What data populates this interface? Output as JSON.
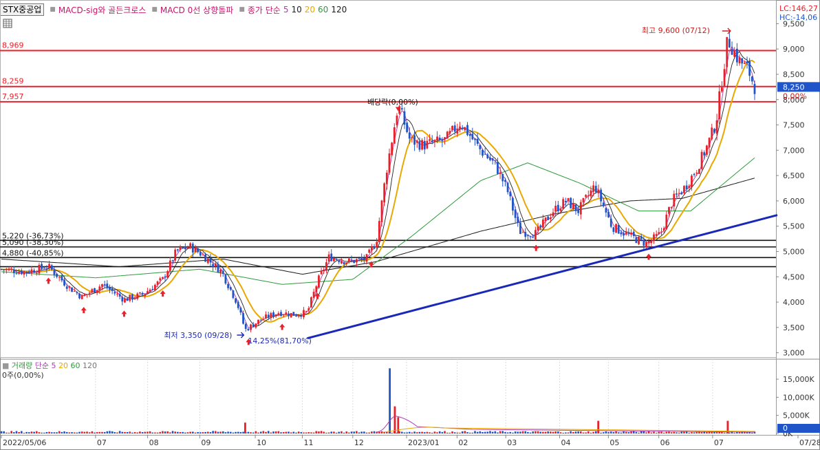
{
  "header": {
    "ticker": "STX중공업",
    "indicators": [
      "MACD-sig와 골든크로스",
      "MACD 0선 상향돌파"
    ],
    "ma_label": "종가 단순",
    "ma_periods": [
      "5",
      "10",
      "20",
      "60",
      "120"
    ],
    "lc": "LC:146,27",
    "hc": "HC:-14,06"
  },
  "volume_panel": {
    "label": "거래량",
    "ma_label": "단순",
    "ma_periods": [
      "5",
      "20",
      "60",
      "120"
    ],
    "sub_label": "0주(0,00%)"
  },
  "annotations": {
    "high": "최고 9,600 (07/12)",
    "low": "최저 3,350 (09/28)",
    "low_pct": "14,25%(81,70%)",
    "dividend": "배당락(0,00%)"
  },
  "right_tags": {
    "price": "8,250",
    "pct": "0,00%",
    "volume": "0"
  },
  "colors": {
    "up": "#e8202a",
    "down": "#1f55c8",
    "ma5": "#b03ab8",
    "ma10": "#202020",
    "ma20": "#e8a800",
    "ma60": "#2e9a3a",
    "ma120": "#1a1a1a",
    "trend": "#1a28b8",
    "level": "#e8202a"
  },
  "chart_data": [
    {
      "type": "candlestick",
      "title": "STX중공업",
      "y_range": [
        2900,
        9750
      ],
      "y_ticks": [
        "9,500",
        "9,000",
        "8,500",
        "8,000",
        "7,500",
        "7,000",
        "6,500",
        "6,000",
        "5,500",
        "5,000",
        "4,500",
        "4,000",
        "3,500",
        "3,000"
      ],
      "x_ticks": [
        "2022/05/06",
        "07",
        "08",
        "09",
        "10",
        "11",
        "12",
        "2023/01",
        "02",
        "03",
        "04",
        "05",
        "06",
        "07",
        "07/28"
      ],
      "red_levels": [
        {
          "label": "8,969",
          "value": 8969
        },
        {
          "label": "8,259",
          "value": 8259
        },
        {
          "label": "7,957",
          "value": 7957
        }
      ],
      "black_levels": [
        {
          "label": "5,220 (-36,73%)",
          "value": 5220
        },
        {
          "label": "5,090 (-38,30%)",
          "value": 5090
        },
        {
          "label": "4,880 (-40,85%)",
          "value": 4880
        },
        {
          "value": 4700
        }
      ],
      "trend_line": {
        "from": {
          "date": "2022-09-28",
          "value": 3240
        },
        "to": {
          "date": "2023-07-31",
          "value": 5720
        }
      },
      "price_anchors": [
        {
          "date": "2022-05-06",
          "close": 4650
        },
        {
          "date": "2022-05-20",
          "close": 4600
        },
        {
          "date": "2022-06-03",
          "close": 4700
        },
        {
          "date": "2022-06-15",
          "close": 4300
        },
        {
          "date": "2022-06-23",
          "close": 4100
        },
        {
          "date": "2022-07-05",
          "close": 4350
        },
        {
          "date": "2022-07-18",
          "close": 4050
        },
        {
          "date": "2022-07-29",
          "close": 4150
        },
        {
          "date": "2022-08-10",
          "close": 4450
        },
        {
          "date": "2022-08-18",
          "close": 5000
        },
        {
          "date": "2022-08-26",
          "close": 5100
        },
        {
          "date": "2022-09-02",
          "close": 4950
        },
        {
          "date": "2022-09-14",
          "close": 4600
        },
        {
          "date": "2022-09-23",
          "close": 4000
        },
        {
          "date": "2022-09-28",
          "close": 3450
        },
        {
          "date": "2022-10-07",
          "close": 3650
        },
        {
          "date": "2022-10-18",
          "close": 3800
        },
        {
          "date": "2022-10-28",
          "close": 3750
        },
        {
          "date": "2022-11-04",
          "close": 3800
        },
        {
          "date": "2022-11-10",
          "close": 4400
        },
        {
          "date": "2022-11-17",
          "close": 4900
        },
        {
          "date": "2022-11-28",
          "close": 4800
        },
        {
          "date": "2022-12-09",
          "close": 4850
        },
        {
          "date": "2022-12-15",
          "close": 5200
        },
        {
          "date": "2022-12-21",
          "close": 6600
        },
        {
          "date": "2022-12-28",
          "close": 7900
        },
        {
          "date": "2023-01-04",
          "close": 7200
        },
        {
          "date": "2023-01-12",
          "close": 7100
        },
        {
          "date": "2023-01-25",
          "close": 7200
        },
        {
          "date": "2023-02-03",
          "close": 7550
        },
        {
          "date": "2023-02-15",
          "close": 7000
        },
        {
          "date": "2023-02-24",
          "close": 6700
        },
        {
          "date": "2023-03-03",
          "close": 6200
        },
        {
          "date": "2023-03-10",
          "close": 5400
        },
        {
          "date": "2023-03-20",
          "close": 5350
        },
        {
          "date": "2023-03-30",
          "close": 5800
        },
        {
          "date": "2023-04-07",
          "close": 6000
        },
        {
          "date": "2023-04-14",
          "close": 5800
        },
        {
          "date": "2023-04-24",
          "close": 6300
        },
        {
          "date": "2023-05-04",
          "close": 5500
        },
        {
          "date": "2023-05-15",
          "close": 5300
        },
        {
          "date": "2023-05-25",
          "close": 5150
        },
        {
          "date": "2023-06-02",
          "close": 5350
        },
        {
          "date": "2023-06-09",
          "close": 6000
        },
        {
          "date": "2023-06-16",
          "close": 6250
        },
        {
          "date": "2023-06-23",
          "close": 6600
        },
        {
          "date": "2023-06-30",
          "close": 7100
        },
        {
          "date": "2023-07-05",
          "close": 7550
        },
        {
          "date": "2023-07-12",
          "close": 9200
        },
        {
          "date": "2023-07-18",
          "close": 8800
        },
        {
          "date": "2023-07-24",
          "close": 8600
        },
        {
          "date": "2023-07-28",
          "close": 8250
        }
      ],
      "ma60_points": [
        {
          "date": "2022-05-06",
          "value": 4600
        },
        {
          "date": "2022-07-01",
          "value": 4480
        },
        {
          "date": "2022-09-01",
          "value": 4650
        },
        {
          "date": "2022-10-20",
          "value": 4350
        },
        {
          "date": "2022-12-01",
          "value": 4450
        },
        {
          "date": "2023-01-05",
          "value": 5300
        },
        {
          "date": "2023-02-15",
          "value": 6400
        },
        {
          "date": "2023-03-15",
          "value": 6750
        },
        {
          "date": "2023-04-15",
          "value": 6350
        },
        {
          "date": "2023-05-20",
          "value": 5800
        },
        {
          "date": "2023-06-20",
          "value": 5800
        },
        {
          "date": "2023-07-28",
          "value": 6850
        }
      ],
      "ma120_points": [
        {
          "date": "2022-05-06",
          "value": 4850
        },
        {
          "date": "2022-07-15",
          "value": 4700
        },
        {
          "date": "2022-09-15",
          "value": 4850
        },
        {
          "date": "2022-11-01",
          "value": 4550
        },
        {
          "date": "2022-12-15",
          "value": 4800
        },
        {
          "date": "2023-02-15",
          "value": 5400
        },
        {
          "date": "2023-04-01",
          "value": 5750
        },
        {
          "date": "2023-05-15",
          "value": 6000
        },
        {
          "date": "2023-06-15",
          "value": 6050
        },
        {
          "date": "2023-07-28",
          "value": 6450
        }
      ],
      "buy_signal_dates": [
        "2022-06-03",
        "2022-06-24",
        "2022-07-18",
        "2022-08-10",
        "2022-09-30",
        "2022-10-20",
        "2022-11-10",
        "2022-12-12",
        "2023-03-20",
        "2023-05-26"
      ],
      "sell_signal_dates": [
        "2022-12-28"
      ],
      "volume": {
        "y_range": [
          0,
          19000
        ],
        "y_ticks": [
          "15,000K",
          "10,000K",
          "5,000K",
          "0K"
        ],
        "spike_dates": [
          "2022-09-28",
          "2022-12-23",
          "2022-12-26",
          "2022-12-28",
          "2023-04-26",
          "2023-07-12"
        ],
        "spike_values": [
          3000,
          18000,
          7500,
          4500,
          3500,
          3500
        ]
      }
    }
  ]
}
